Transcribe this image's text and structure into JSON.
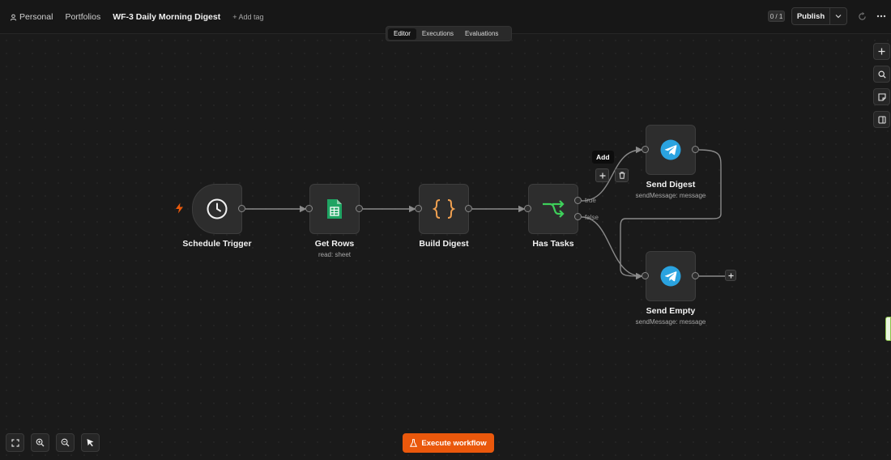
{
  "header": {
    "breadcrumb": {
      "project": "Personal",
      "folder": "Portfolios",
      "workflow_name": "WF-3 Daily Morning Digest",
      "add_tag": "+ Add tag"
    },
    "counter": "0 / 1",
    "publish_label": "Publish"
  },
  "tabs": [
    {
      "label": "Editor",
      "active": true
    },
    {
      "label": "Executions",
      "active": false
    },
    {
      "label": "Evaluations",
      "active": false
    }
  ],
  "nodes": {
    "schedule_trigger": {
      "label": "Schedule Trigger",
      "icon": "clock-icon"
    },
    "get_rows": {
      "label": "Get Rows",
      "subtitle": "read: sheet",
      "icon": "google-sheets-icon"
    },
    "build_digest": {
      "label": "Build Digest",
      "icon": "braces-icon"
    },
    "has_tasks": {
      "label": "Has Tasks",
      "icon": "if-branch-icon"
    },
    "send_digest": {
      "label": "Send Digest",
      "subtitle": "sendMessage: message",
      "icon": "telegram-icon"
    },
    "send_empty": {
      "label": "Send Empty",
      "subtitle": "sendMessage: message",
      "icon": "telegram-icon"
    }
  },
  "branches": {
    "true_label": "true",
    "false_label": "false"
  },
  "edge_tooltip": "Add",
  "execute_label": "Execute workflow",
  "colors": {
    "accent": "#ea580c",
    "trigger_bolt": "#e8590c",
    "sheets_green": "#1fa463",
    "braces_orange": "#f0a050",
    "if_green": "#3ecf5a",
    "telegram_blue": "#2aa3e0",
    "canvas_bg": "#1a1a1a"
  }
}
